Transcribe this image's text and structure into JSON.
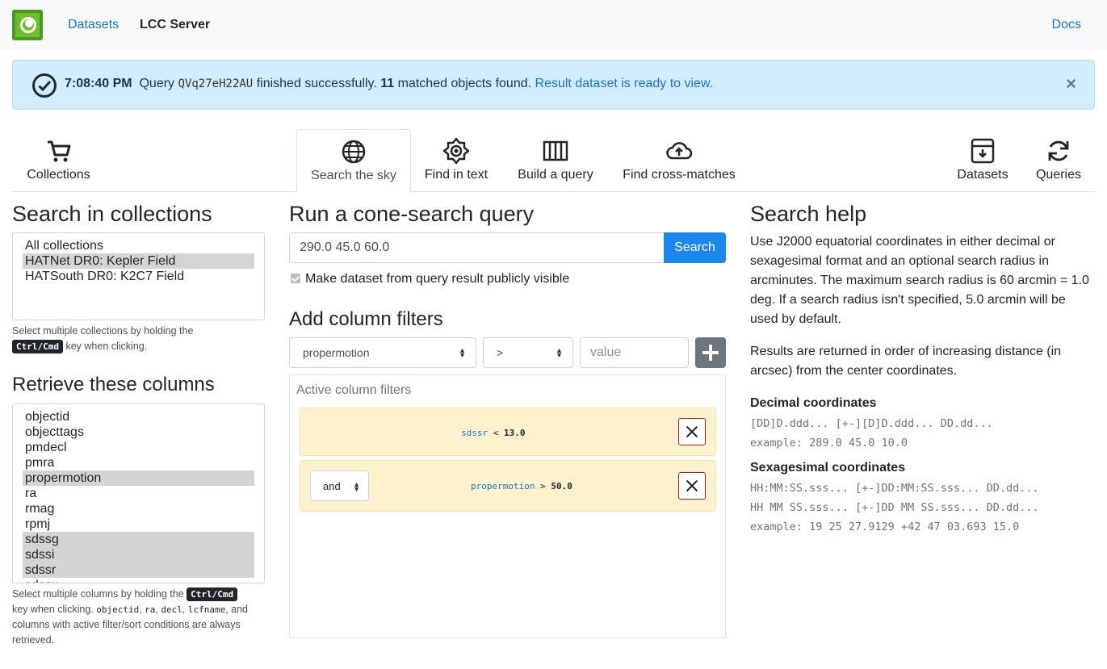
{
  "navbar": {
    "datasets_link": "Datasets",
    "brand": "LCC Server",
    "docs_link": "Docs"
  },
  "alert": {
    "time": "7:08:40 PM",
    "query_word": "Query",
    "query_id": "QVq27eH22AU",
    "finished_text": "finished successfully.",
    "matched_count": "11",
    "matched_text": "matched objects found.",
    "result_link": "Result dataset is ready to view.",
    "close": "×"
  },
  "tabs": [
    {
      "label": "Collections",
      "icon": "cart-icon"
    },
    {
      "label": "Search the sky",
      "icon": "globe-icon"
    },
    {
      "label": "Find in text",
      "icon": "sun-icon"
    },
    {
      "label": "Build a query",
      "icon": "columns-icon"
    },
    {
      "label": "Find cross-matches",
      "icon": "cloud-upload-icon"
    },
    {
      "label": "Datasets",
      "icon": "archive-icon"
    },
    {
      "label": "Queries",
      "icon": "refresh-icon"
    }
  ],
  "collections": {
    "title": "Search in collections",
    "options": [
      "All collections",
      "HATNet DR0: Kepler Field",
      "HATSouth DR0: K2C7 Field"
    ],
    "hint_before": "Select multiple collections by holding the",
    "hint_kbd": "Ctrl/Cmd",
    "hint_after": "key when clicking."
  },
  "columns": {
    "title": "Retrieve these columns",
    "options": [
      "objectid",
      "objecttags",
      "pmdecl",
      "pmra",
      "propermotion",
      "ra",
      "rmag",
      "rpmj",
      "sdssg",
      "sdssi",
      "sdssr",
      "sdssu"
    ],
    "hint_before": "Select multiple columns by holding the",
    "hint_kbd": "Ctrl/Cmd",
    "hint_mid": "key when clicking.",
    "code1": "objectid",
    "code2": "ra",
    "code3": "decl",
    "code4": "lcfname",
    "hint_end1": ", and",
    "hint_end2": "columns with active filter/sort conditions are always retrieved."
  },
  "cone": {
    "title": "Run a cone-search query",
    "input_value": "290.0 45.0 60.0",
    "search_button": "Search",
    "public_label": "Make dataset from query result publicly visible"
  },
  "filters": {
    "title": "Add column filters",
    "column_select": "propermotion",
    "operator_select": ">",
    "value_placeholder": "value",
    "active_title": "Active column filters",
    "rows": [
      {
        "column": "sdssr",
        "op": "<",
        "value": "13.0"
      },
      {
        "conj": "and",
        "column": "propermotion",
        "op": ">",
        "value": "50.0"
      }
    ]
  },
  "help": {
    "title": "Search help",
    "p1": "Use J2000 equatorial coordinates in either decimal or sexagesimal format and an optional search radius in arcminutes. The maximum search radius is 60 arcmin = 1.0 deg. If a search radius isn't specified, 5.0 arcmin will be used by default.",
    "p2": "Results are returned in order of increasing distance (in arcsec) from the center coordinates.",
    "decimal_title": "Decimal coordinates",
    "decimal_format": "[DD]D.ddd... [+-][D]D.ddd... DD.dd...",
    "decimal_example": "example: 289.0 45.0 10.0",
    "sexa_title": "Sexagesimal coordinates",
    "sexa_format1": "HH:MM:SS.sss... [+-]DD:MM:SS.sss... DD.dd...",
    "sexa_format2": "HH MM SS.sss... [+-]DD MM SS.sss... DD.dd...",
    "sexa_example": "example: 19 25 27.9129 +42 47 03.693 15.0"
  },
  "colors": {
    "accent": "#1a86ee",
    "alert_bg": "#d1ecfb",
    "filter_bg": "#fdf2cd",
    "logo_green": "#6cbf2f"
  }
}
